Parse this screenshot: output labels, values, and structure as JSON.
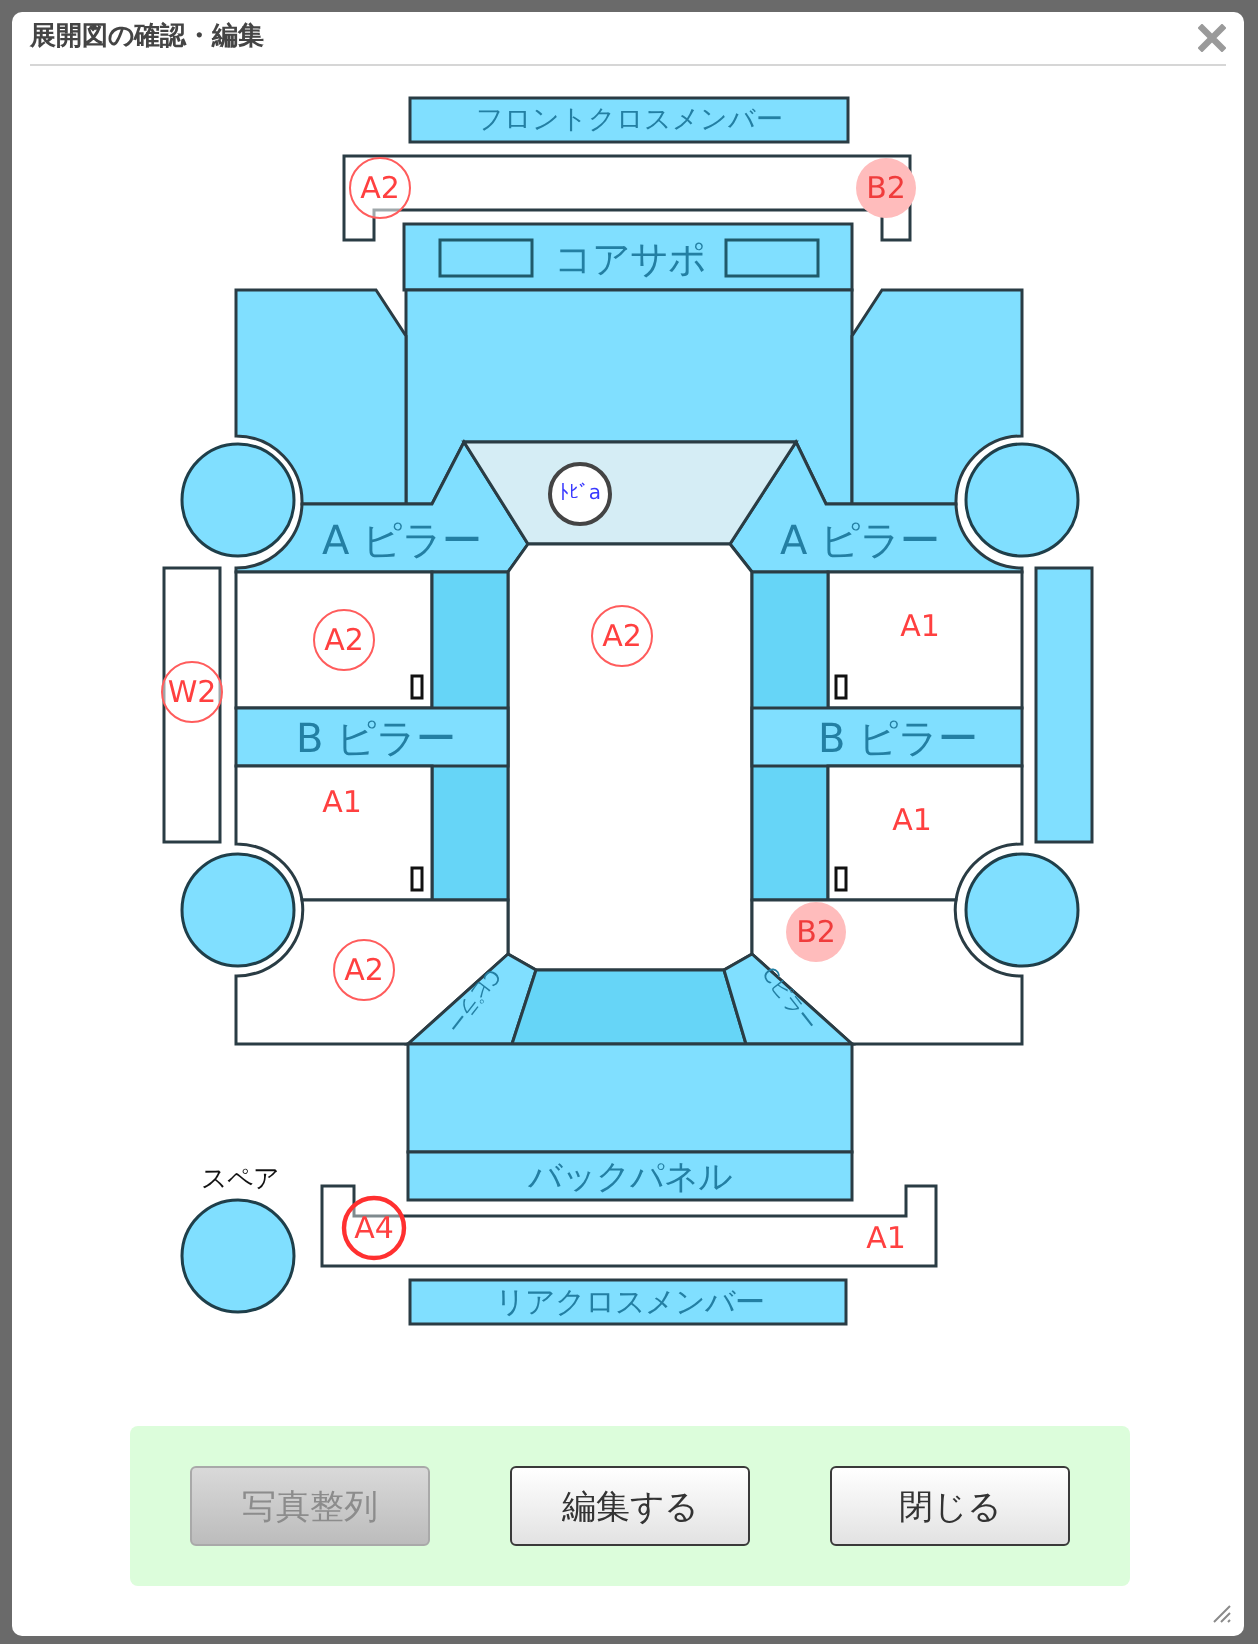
{
  "dialog": {
    "title": "展開図の確認・編集"
  },
  "diagram": {
    "part_labels": [
      "フロントクロスメンバー",
      "コアサポ",
      "A ピラー",
      "A ピラー",
      "B ピラー",
      "B ピラー",
      "Cピラー",
      "Cピラー",
      "バックパネル",
      "リアクロスメンバー"
    ],
    "spare_label": "スペア",
    "marks": [
      {
        "code": "A2",
        "kind": "circled"
      },
      {
        "code": "B2",
        "kind": "shaded"
      },
      {
        "code": "ﾄﾋﾞa",
        "kind": "ringed"
      },
      {
        "code": "A2",
        "kind": "circled"
      },
      {
        "code": "A2",
        "kind": "circled"
      },
      {
        "code": "A1",
        "kind": "plain"
      },
      {
        "code": "W2",
        "kind": "circled"
      },
      {
        "code": "A1",
        "kind": "plain"
      },
      {
        "code": "A1",
        "kind": "plain"
      },
      {
        "code": "B2",
        "kind": "shaded"
      },
      {
        "code": "A2",
        "kind": "circled"
      },
      {
        "code": "A4",
        "kind": "bold"
      },
      {
        "code": "A1",
        "kind": "plain"
      }
    ]
  },
  "buttons": [
    {
      "label": "写真整列",
      "disabled": true
    },
    {
      "label": "編集する",
      "disabled": false
    },
    {
      "label": "閉じる",
      "disabled": false
    }
  ]
}
